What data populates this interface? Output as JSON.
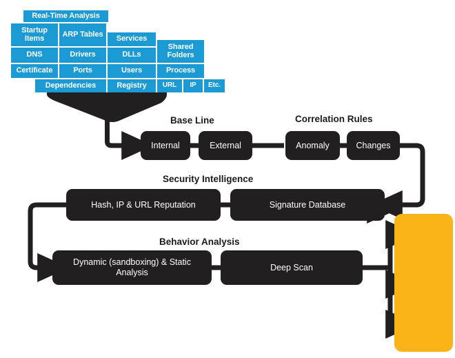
{
  "diagram": {
    "title_hidden": "",
    "colors": {
      "tile_blue": "#1B9AD4",
      "box_dark": "#221F20",
      "panel_yellow": "#F9B517",
      "icon_cyan": "#2AA9D4",
      "background": "#FFFFFF"
    }
  },
  "collector": {
    "header": {
      "label": "Real-Time Analysis"
    },
    "tiles": [
      {
        "label": "Startup Items"
      },
      {
        "label": "ARP Tables"
      },
      {
        "label": "Services"
      },
      {
        "label": "Shared Folders"
      },
      {
        "label": "DNS"
      },
      {
        "label": "Drivers"
      },
      {
        "label": "DLLs"
      },
      {
        "label": "Certificate"
      },
      {
        "label": "Ports"
      },
      {
        "label": "Users"
      },
      {
        "label": "Process"
      },
      {
        "label": "Dependencies"
      },
      {
        "label": "Registry"
      },
      {
        "label": "URL"
      },
      {
        "label": "IP"
      },
      {
        "label": "Etc."
      }
    ]
  },
  "stages": [
    {
      "caption": "Base Line",
      "boxes": [
        {
          "label": "Internal"
        },
        {
          "label": "External"
        }
      ]
    },
    {
      "caption": "Correlation Rules",
      "boxes": [
        {
          "label": "Anomaly"
        },
        {
          "label": "Changes"
        }
      ]
    },
    {
      "caption": "Security Intelligence",
      "boxes": [
        {
          "label": "Hash, IP & URL Reputation"
        },
        {
          "label": "Signature Database"
        }
      ]
    },
    {
      "caption": "Behavior Analysis",
      "boxes": [
        {
          "label": "Dynamic (sandboxing) & Static Analysis"
        },
        {
          "label": "Deep Scan"
        }
      ]
    }
  ],
  "verdicts": [
    {
      "icon": "thumbs-up-icon",
      "label": ""
    },
    {
      "icon": "bomb-question-icon",
      "label": "?"
    },
    {
      "icon": "bomb-biohazard-icon",
      "label": ""
    }
  ]
}
